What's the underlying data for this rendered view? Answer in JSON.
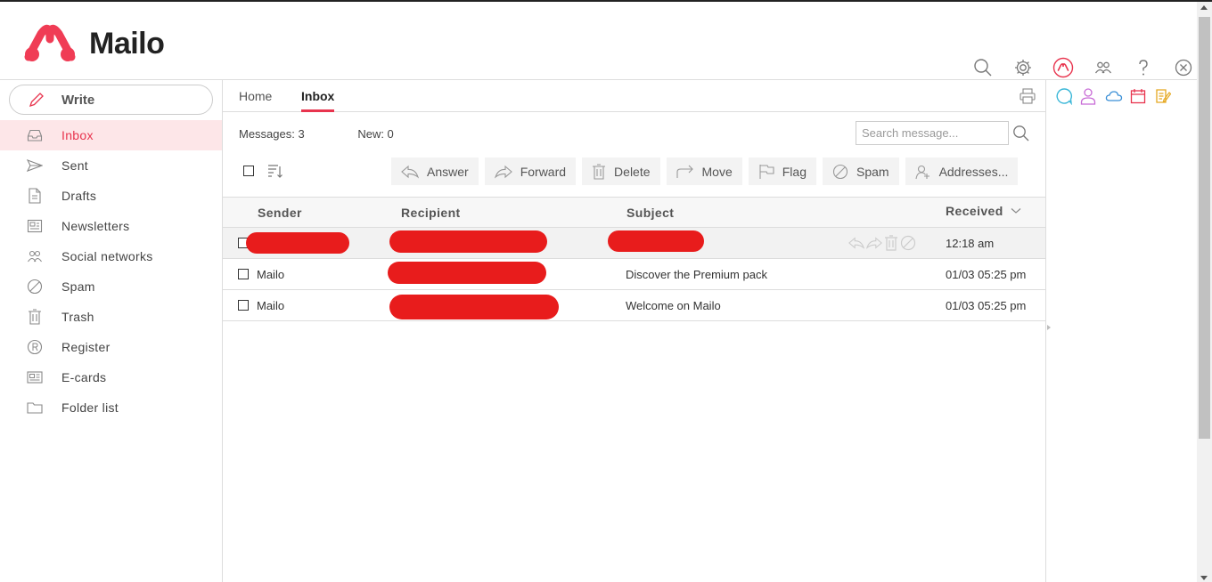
{
  "app": {
    "name": "Mailo",
    "brand_color": "#e8344e"
  },
  "toolbar_icons": [
    "search-icon",
    "gear-icon",
    "mailo-icon",
    "contacts-icon",
    "help-icon",
    "close-icon"
  ],
  "sidebar": {
    "write_label": "Write",
    "items": [
      {
        "label": "Inbox",
        "icon": "inbox-icon",
        "active": true
      },
      {
        "label": "Sent",
        "icon": "send-icon"
      },
      {
        "label": "Drafts",
        "icon": "draft-icon"
      },
      {
        "label": "Newsletters",
        "icon": "newsletter-icon"
      },
      {
        "label": "Social networks",
        "icon": "people-icon"
      },
      {
        "label": "Spam",
        "icon": "spam-icon"
      },
      {
        "label": "Trash",
        "icon": "trash-icon"
      },
      {
        "label": "Register",
        "icon": "register-icon"
      },
      {
        "label": "E-cards",
        "icon": "ecard-icon"
      },
      {
        "label": "Folder list",
        "icon": "folder-icon"
      }
    ]
  },
  "tabs": {
    "home": "Home",
    "inbox": "Inbox"
  },
  "stats": {
    "messages": "Messages: 3",
    "new": "New: 0"
  },
  "search": {
    "placeholder": "Search message..."
  },
  "actions": [
    {
      "label": "Answer",
      "icon": "reply-icon"
    },
    {
      "label": "Forward",
      "icon": "forward-icon"
    },
    {
      "label": "Delete",
      "icon": "trash-icon"
    },
    {
      "label": "Move",
      "icon": "move-icon"
    },
    {
      "label": "Flag",
      "icon": "flag-icon"
    },
    {
      "label": "Spam",
      "icon": "spam-icon"
    },
    {
      "label": "Addresses...",
      "icon": "add-contact-icon"
    }
  ],
  "table": {
    "headers": {
      "sender": "Sender",
      "recipient": "Recipient",
      "subject": "Subject",
      "received": "Received"
    },
    "rows": [
      {
        "sender": "",
        "subject": "",
        "received": "12:18 am"
      },
      {
        "sender": "Mailo",
        "subject": "Discover the Premium pack",
        "received": "01/03 05:25 pm"
      },
      {
        "sender": "Mailo",
        "subject": "Welcome on Mailo",
        "received": "01/03 05:25 pm"
      }
    ]
  },
  "right_panel_icons": [
    "chat-icon",
    "contact-icon",
    "cloud-icon",
    "calendar-icon",
    "notes-icon"
  ]
}
